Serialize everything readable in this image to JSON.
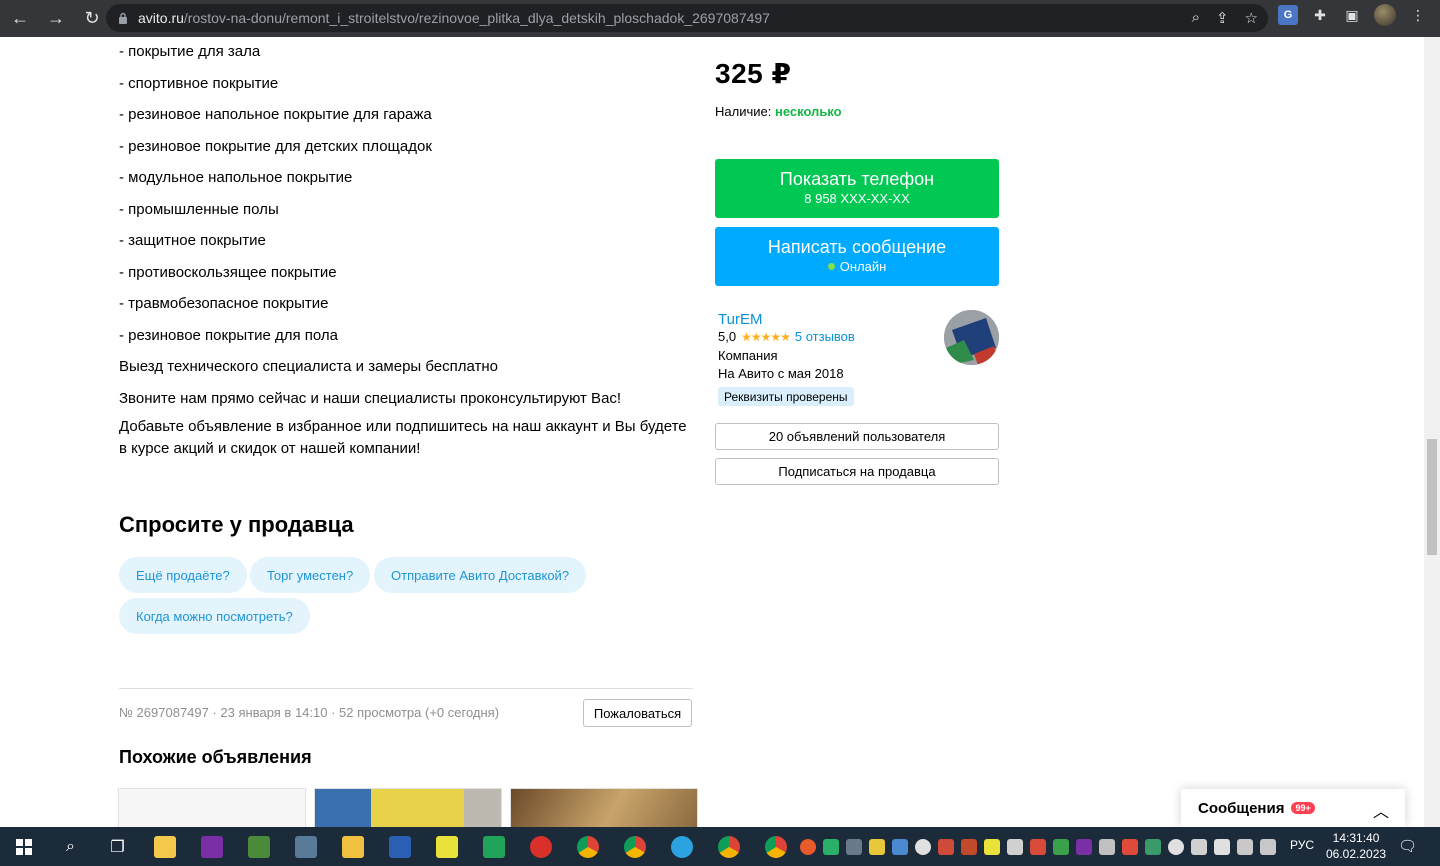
{
  "browser": {
    "url_host": "avito.ru",
    "url_path": "/rostov-na-donu/remont_i_stroitelstvo/rezinovoe_plitka_dlya_detskih_ploschadok_2697087497"
  },
  "description": {
    "lines": [
      "- покрытие для зала",
      "- спортивное покрытие",
      "- резиновое напольное покрытие для гаража",
      "- резиновое покрытие для детских площадок",
      "- модульное напольное покрытие",
      "- промышленные полы",
      "- защитное покрытие",
      "- противоскользящее покрытие",
      "- травмобезопасное покрытие",
      "- резиновое покрытие для пола",
      "Выезд технического специалиста и замеры бесплатно",
      "Звоните нам прямо сейчас и наши специалисты проконсультируют Вас!"
    ],
    "final_paragraph": "Добавьте объявление в избранное или подпишитесь на наш аккаунт и Вы будете в курсе акций и скидок от нашей компании!"
  },
  "ask_seller": {
    "title": "Спросите у продавца",
    "chips": [
      "Ещё продаёте?",
      "Торг уместен?",
      "Отправите Авито Доставкой?",
      "Когда можно посмотреть?"
    ]
  },
  "listing_meta": {
    "text": "№ 2697087497 · 23 января в 14:10 · 52 просмотра (+0 сегодня)",
    "complain_label": "Пожаловаться"
  },
  "similar": {
    "title": "Похожие объявления"
  },
  "offer": {
    "price": "325 ₽",
    "availability_label": "Наличие:",
    "availability_value": "несколько",
    "phone_button": {
      "title": "Показать телефон",
      "subtitle": "8 958 XXX-XX-XX"
    },
    "message_button": {
      "title": "Написать сообщение",
      "subtitle": "Онлайн"
    }
  },
  "seller": {
    "name": "TurEM",
    "rating": "5,0",
    "stars": "★★★★★",
    "reviews": "5 отзывов",
    "type": "Компания",
    "since": "На Авито с мая 2018",
    "verified": "Реквизиты проверены",
    "listings_button": "20 объявлений пользователя",
    "subscribe_button": "Подписаться на продавца"
  },
  "messages_panel": {
    "title": "Сообщения",
    "badge": "99+"
  },
  "taskbar": {
    "lang": "РУС",
    "time": "14:31:40",
    "date": "06.02.2023"
  },
  "colors": {
    "green": "#00c853",
    "blue": "#00aaff",
    "link": "#0a90d6",
    "chip_bg": "#e3f4fd"
  }
}
